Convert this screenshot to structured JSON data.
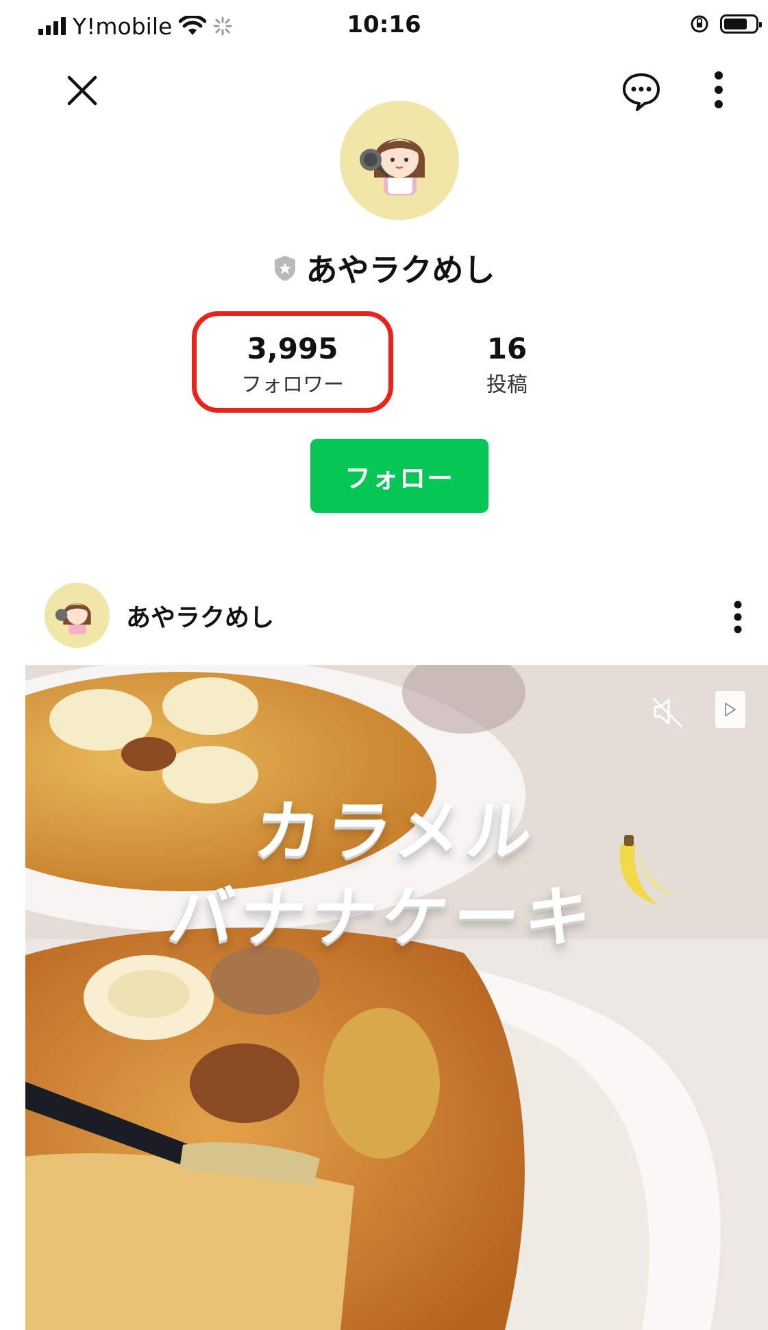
{
  "status_bar": {
    "carrier": "Y!mobile",
    "time": "10:16"
  },
  "profile": {
    "name": "あやラクめし",
    "followers_count": "3,995",
    "followers_label": "フォロワー",
    "posts_count": "16",
    "posts_label": "投稿",
    "follow_button": "フォロー"
  },
  "post": {
    "author": "あやラクめし",
    "overlay_line1": "カラメル",
    "overlay_line2": "バナナケーキ"
  },
  "icons": {
    "close": "close-icon",
    "chat": "chat-bubble-icon",
    "more": "more-vertical-icon",
    "verified": "shield-badge-icon",
    "mute": "mute-icon",
    "play": "play-icon"
  },
  "colors": {
    "accent": "#06c755",
    "highlight": "#e8231b"
  }
}
